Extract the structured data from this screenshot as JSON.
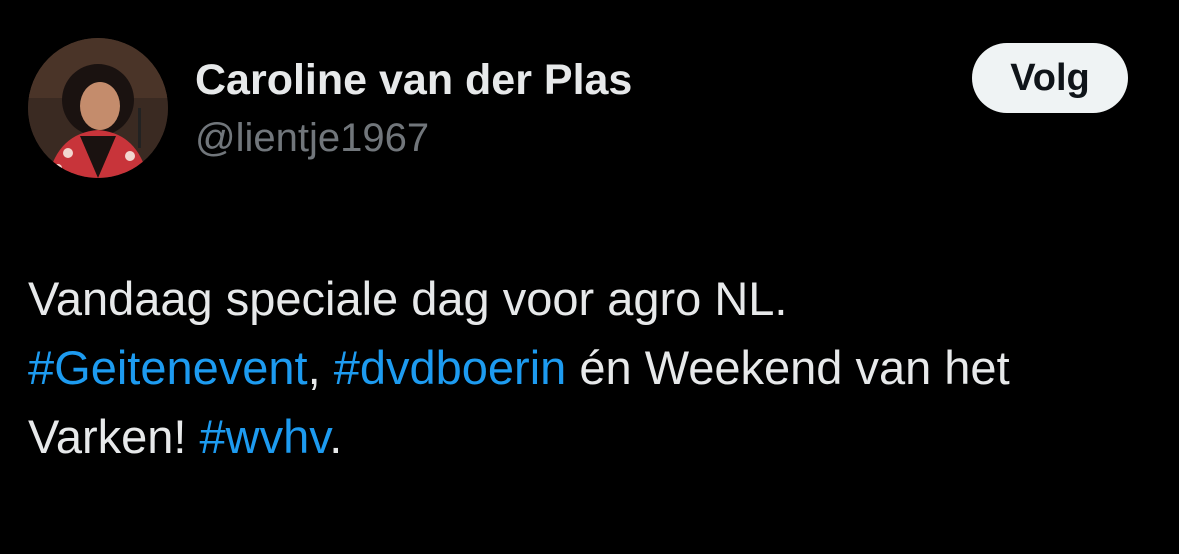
{
  "author": {
    "name": "Caroline van der Plas",
    "handle": "@lientje1967",
    "avatar_icon": "profile-photo-avatar"
  },
  "follow_button": {
    "label": "Volg"
  },
  "tweet": {
    "line1": "Vandaag speciale dag voor agro NL.",
    "hashtag1": "#Geitenevent",
    "sep1": ", ",
    "hashtag2": "#dvdboerin",
    "middle": " én Weekend van het Varken! ",
    "hashtag3": "#wvhv",
    "end": "."
  },
  "colors": {
    "background": "#000000",
    "text": "#e7e9ea",
    "muted": "#71767b",
    "link": "#1d9bf0",
    "button_bg": "#eff3f4"
  }
}
